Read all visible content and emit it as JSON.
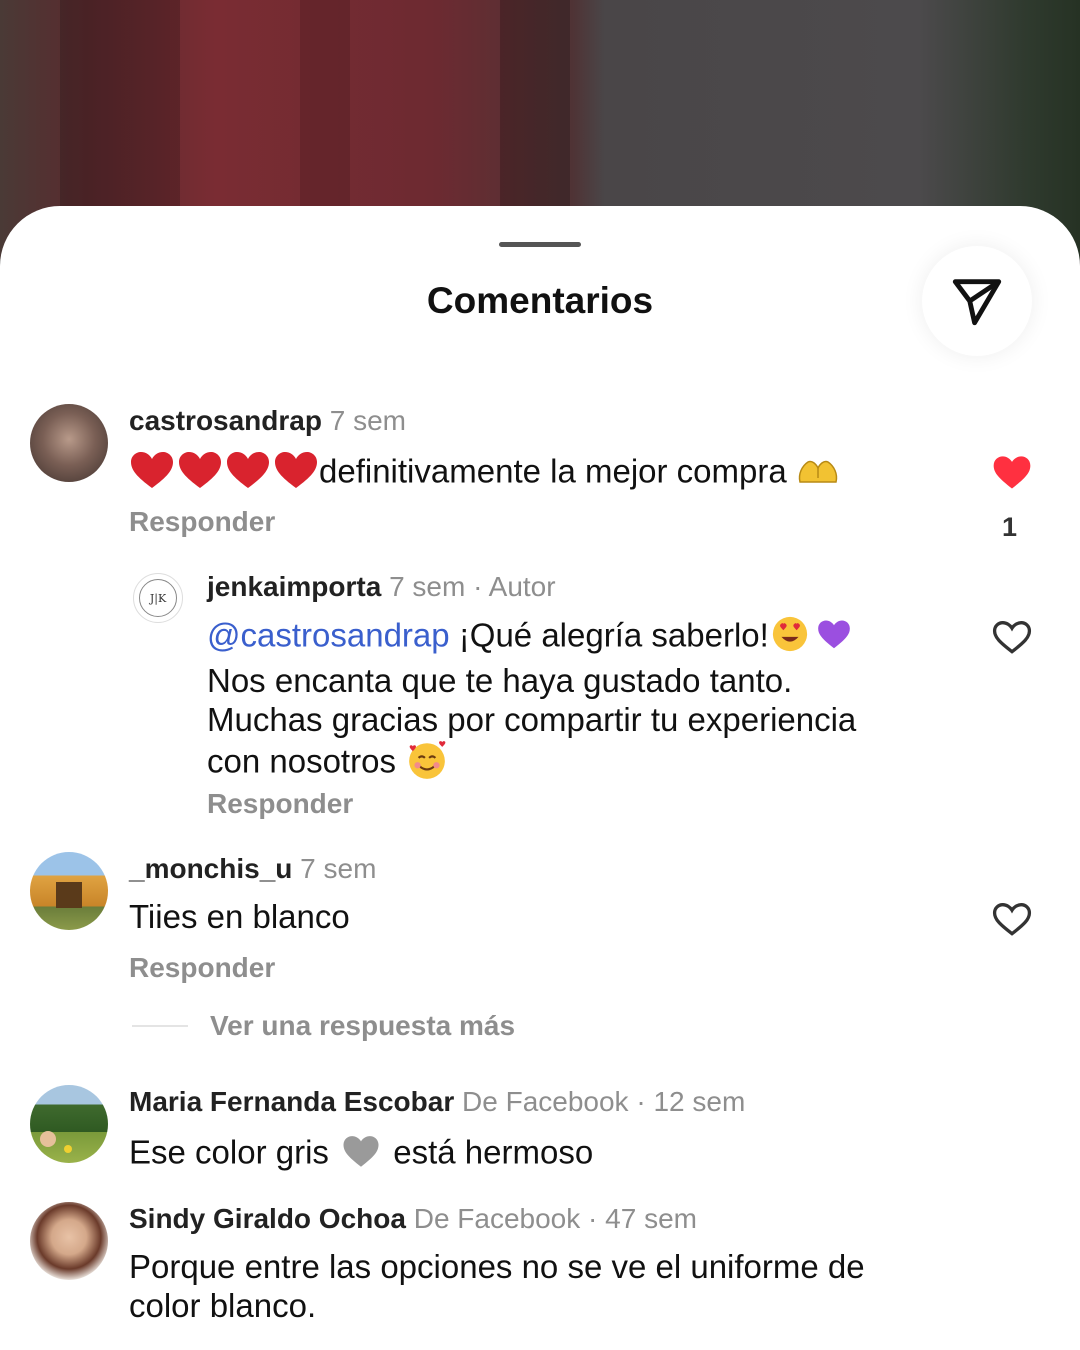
{
  "sheet": {
    "title": "Comentarios",
    "share_icon": "send-paper-plane-icon"
  },
  "comments": [
    {
      "username": "castrosandrap",
      "time": "7 sem",
      "text": "definitivamente la mejor compra",
      "emoji_prefix": "red-heart x4",
      "emoji_suffix": "heart-hands",
      "reply_label": "Responder",
      "liked": true,
      "like_count": "1"
    },
    {
      "username": "jenkaimporta",
      "time": "7 sem",
      "author_tag": "· Autor",
      "mention": "@castrosandrap",
      "line1": "¡Qué alegría saberlo!",
      "line2": "Nos encanta que te haya gustado tanto.",
      "line3": "Muchas gracias por compartir tu experiencia",
      "line4": "con nosotros",
      "reply_label": "Responder",
      "avatar_text": "J|K",
      "liked": false
    },
    {
      "username": "_monchis_u",
      "time": "7 sem",
      "text": "Tiies en blanco",
      "reply_label": "Responder",
      "more_replies": "Ver una respuesta más",
      "liked": false
    },
    {
      "username": "Maria Fernanda Escobar",
      "source": "De Facebook",
      "time": "· 12 sem",
      "text_before": "Ese color gris",
      "text_after": "está hermoso"
    },
    {
      "username": "Sindy Giraldo Ochoa",
      "source": "De Facebook",
      "time": "· 47 sem",
      "line1": "Porque entre las opciones no se ve el uniforme de",
      "line2": "color blanco."
    }
  ],
  "colors": {
    "heart_red": "#ff3040",
    "mention_blue": "#3a5fcd",
    "muted_gray": "#8e8e8e"
  }
}
